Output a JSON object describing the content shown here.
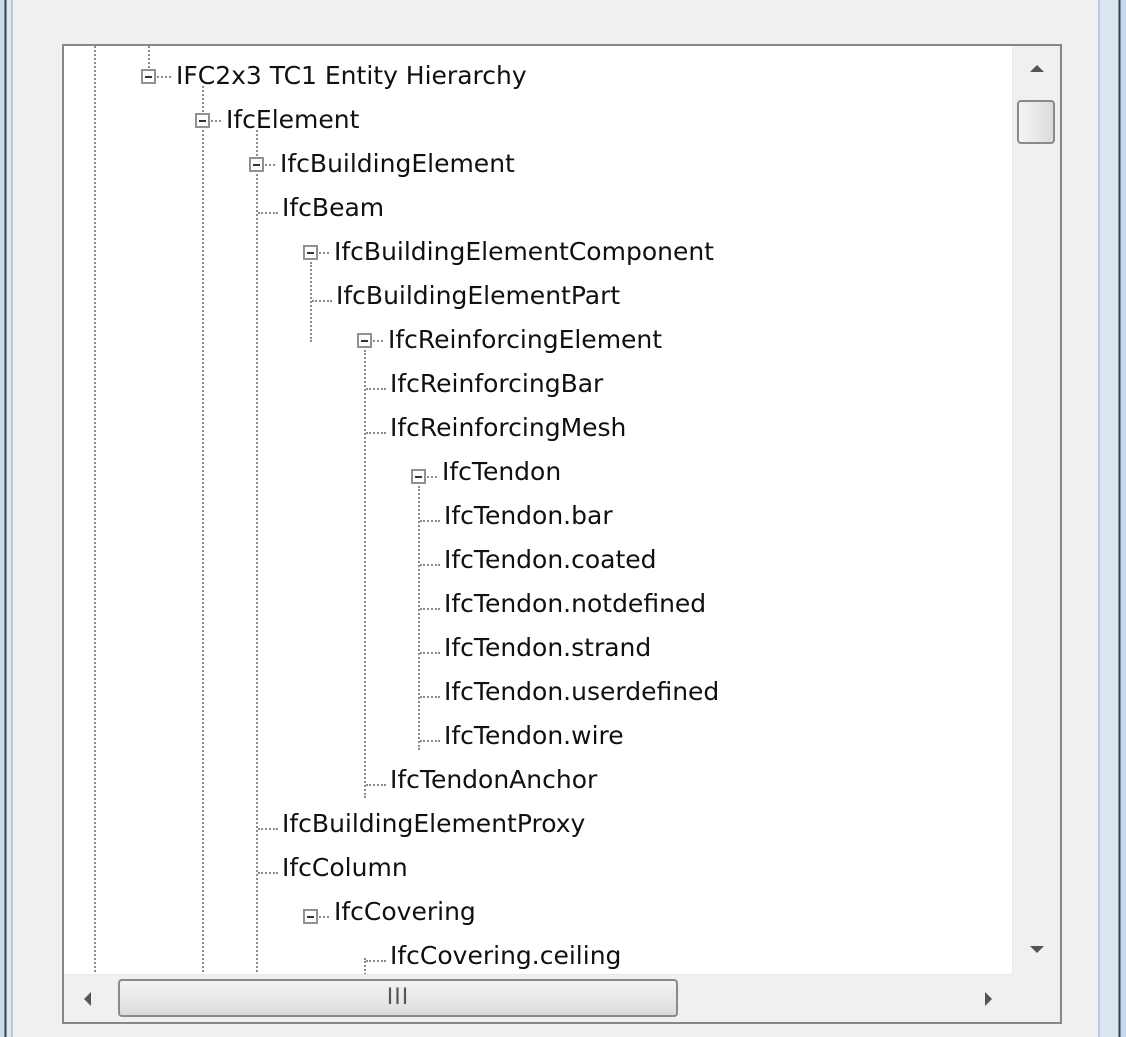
{
  "tree": {
    "root": {
      "label": "IFC2x3 TC1 Entity Hierarchy"
    },
    "nodes": [
      {
        "label": "IfcElement"
      },
      {
        "label": "IfcBuildingElement"
      },
      {
        "label": "IfcBeam"
      },
      {
        "label": "IfcBuildingElementComponent"
      },
      {
        "label": "IfcBuildingElementPart"
      },
      {
        "label": "IfcReinforcingElement"
      },
      {
        "label": "IfcReinforcingBar"
      },
      {
        "label": "IfcReinforcingMesh"
      },
      {
        "label": "IfcTendon"
      },
      {
        "label": "IfcTendon.bar"
      },
      {
        "label": "IfcTendon.coated"
      },
      {
        "label": "IfcTendon.notdefined"
      },
      {
        "label": "IfcTendon.strand"
      },
      {
        "label": "IfcTendon.userdefined"
      },
      {
        "label": "IfcTendon.wire"
      },
      {
        "label": "IfcTendonAnchor"
      },
      {
        "label": "IfcBuildingElementProxy"
      },
      {
        "label": "IfcColumn"
      },
      {
        "label": "IfcCovering"
      },
      {
        "label": "IfcCovering.ceiling"
      }
    ]
  },
  "scrollbars": {
    "vertical": {
      "up_icon": "arrow-up-icon",
      "down_icon": "arrow-down-icon",
      "position": 0.05
    },
    "horizontal": {
      "left_icon": "arrow-left-icon",
      "right_icon": "arrow-right-icon",
      "grip": "III",
      "position": 0.0
    }
  },
  "colors": {
    "tree_background": "#ffffff",
    "connector": "#8c8c8c",
    "border": "#828790",
    "window_chrome": "#c8dbee"
  }
}
